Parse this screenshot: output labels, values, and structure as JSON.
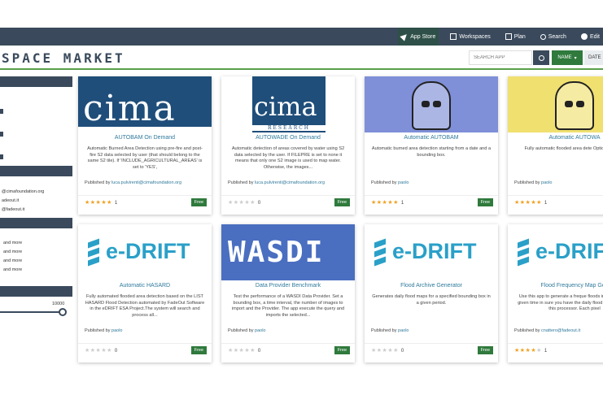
{
  "nav": {
    "items": [
      {
        "label": "App Store",
        "icon": "paper-plane-icon"
      },
      {
        "label": "Workspaces",
        "icon": "workspaces-icon"
      },
      {
        "label": "Plan",
        "icon": "plan-icon"
      },
      {
        "label": "Search",
        "icon": "search-icon"
      },
      {
        "label": "Edit",
        "icon": "globe-icon"
      }
    ]
  },
  "header": {
    "brand": "SPACE MARKET",
    "search_placeholder": "SEARCH APP",
    "sort_name": "NAME",
    "sort_date": "DATE"
  },
  "sidebar": {
    "contacts": [
      "@cimafoundation.org",
      "adeout.it",
      "@fadeout.it"
    ],
    "ratings": [
      "and more",
      "and more",
      "and more",
      "and more"
    ],
    "slider_max": "10000"
  },
  "cards": [
    {
      "title": "AUTOBAM On Demand",
      "desc": "Automatic Burned Area Detection using pre-fire and post-fire S2 data selected by user (that should belong to the same S2 tile). If 'INCLUDE_AGRICULTURAL_AREAS' is set to 'YES',",
      "pub_label": "Published by",
      "author": "luca.pulvirenti@cimafoundation.org",
      "stars": "★★★★★",
      "count": "1",
      "free": "Free",
      "logo": "cima"
    },
    {
      "title": "AUTOWADE On Demand",
      "desc": "Automatic detection of areas covered by water using S2 data selected by the user. If FILEPRE is set to none it means that only one S2 image is used to map water. Otherwise, the images...",
      "pub_label": "Published by",
      "author": "luca.pulvirenti@cimafoundation.org",
      "stars": "★★★★★",
      "count": "0",
      "free": "Free",
      "logo": "cima2"
    },
    {
      "title": "Automatic AUTOBAM",
      "desc": "Automatic burned area detection starting from a date and a bounding box.",
      "pub_label": "Published by",
      "author": "paolo",
      "stars": "★★★★★",
      "count": "1",
      "free": "Free",
      "logo": "robot-blue"
    },
    {
      "title": "Automatic AUTOWA",
      "desc": "Fully automatic flooded area dete Optical images.",
      "pub_label": "Published by",
      "author": "paolo",
      "stars": "★★★★★",
      "count": "1",
      "free": "Free",
      "logo": "robot-yellow"
    },
    {
      "title": "Automatic HASARD",
      "desc": "Fully automated flooded area detection based on the LIST HASARD Flood Detection automated by FadeOut Software in the eDRIFT ESA Project.The system will search and process all...",
      "pub_label": "Published by",
      "author": "paolo",
      "stars": "★★★★★",
      "count": "0",
      "free": "Free",
      "logo": "edrift"
    },
    {
      "title": "Data Provider Benchmark",
      "desc": "Test the performance of a WASDI Data Provider. Set a bounding box, a time interval, the number of images to import and the Provider. The app execute the query and imports the selected...",
      "pub_label": "Published by",
      "author": "paolo",
      "stars": "★★★★★",
      "count": "0",
      "free": "Free",
      "logo": "wasdi"
    },
    {
      "title": "Flood Archive Generator",
      "desc": "Generates daily flood maps for a specified bounding box in a given period.",
      "pub_label": "Published by",
      "author": "paolo",
      "stars": "★★★★★",
      "count": "0",
      "free": "Free",
      "logo": "edrift"
    },
    {
      "title": "Flood Frequency Map Gen",
      "desc": "Use this app to generate a freque floods in an area in a given time in sure you have the daily flood event running this processor. Each pixel",
      "pub_label": "Published by",
      "author": "cnattero@fadeout.it",
      "stars": "★★★★★",
      "count": "1",
      "free": "Free",
      "logo": "edrift"
    }
  ],
  "ratings_on": [
    5,
    0,
    5,
    5,
    0,
    0,
    0,
    4
  ],
  "colors": {
    "nav": "#3a4a5c",
    "accent": "#2f7a3c",
    "link": "#2f7a9c"
  }
}
